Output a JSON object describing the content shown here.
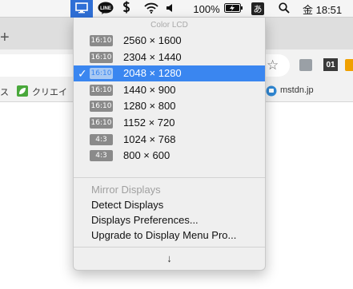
{
  "menubar": {
    "display_icon": "display-icon",
    "line_label": "LINE",
    "dollar_icon": "dollar-icon",
    "wifi_icon": "wifi-icon",
    "volume_icon": "volume-icon",
    "battery_percent": "100%",
    "battery_icon": "battery-charging-icon",
    "ime_label": "あ",
    "search_icon": "spotlight-search-icon",
    "clock": "金 18:51"
  },
  "background": {
    "new_tab": "+",
    "bookmark_partial": "ス",
    "bookmark_creator": "クリエイ",
    "bookmark_mstdn": "mstdn.jp",
    "ext_label": "01"
  },
  "menu": {
    "header": "Color LCD",
    "resolutions": [
      {
        "ratio": "16:10",
        "label": "2560 × 1600",
        "selected": false
      },
      {
        "ratio": "16:10",
        "label": "2304 × 1440",
        "selected": false
      },
      {
        "ratio": "16:10",
        "label": "2048 × 1280",
        "selected": true
      },
      {
        "ratio": "16:10",
        "label": "1440 × 900",
        "selected": false
      },
      {
        "ratio": "16:10",
        "label": "1280 × 800",
        "selected": false
      },
      {
        "ratio": "16:10",
        "label": "1152 × 720",
        "selected": false
      },
      {
        "ratio": "4:3",
        "label": "1024 × 768",
        "selected": false
      },
      {
        "ratio": "4:3",
        "label": "800 × 600",
        "selected": false
      }
    ],
    "checkmark": "✓",
    "actions": {
      "mirror": "Mirror Displays",
      "detect": "Detect Displays",
      "preferences": "Displays Preferences...",
      "upgrade": "Upgrade to Display Menu Pro..."
    },
    "scroll_arrow": "↓"
  },
  "colors": {
    "selection": "#3a86f0",
    "menubar_highlight": "#2f6fd6",
    "disabled_text": "#a0a0a0"
  }
}
